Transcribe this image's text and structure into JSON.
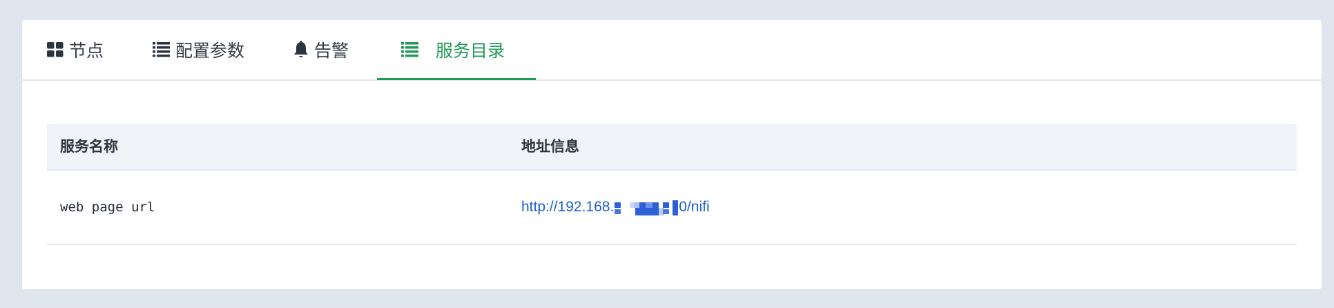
{
  "tabs": [
    {
      "label": "节点",
      "icon": "grid-icon",
      "active": false
    },
    {
      "label": "配置参数",
      "icon": "list-icon",
      "active": false
    },
    {
      "label": "告警",
      "icon": "bell-icon",
      "active": false
    },
    {
      "label": "服务目录",
      "icon": "list-icon",
      "active": true
    }
  ],
  "table": {
    "columns": [
      "服务名称",
      "地址信息"
    ],
    "rows": [
      {
        "name": "web page url",
        "url_prefix": "http://192.168.",
        "url_suffix": "0/nifi"
      }
    ]
  },
  "colors": {
    "accent": "#1f9a57",
    "link": "#1a5fcf",
    "background": "#dfe5ec",
    "header_bg": "#f0f4f9"
  }
}
